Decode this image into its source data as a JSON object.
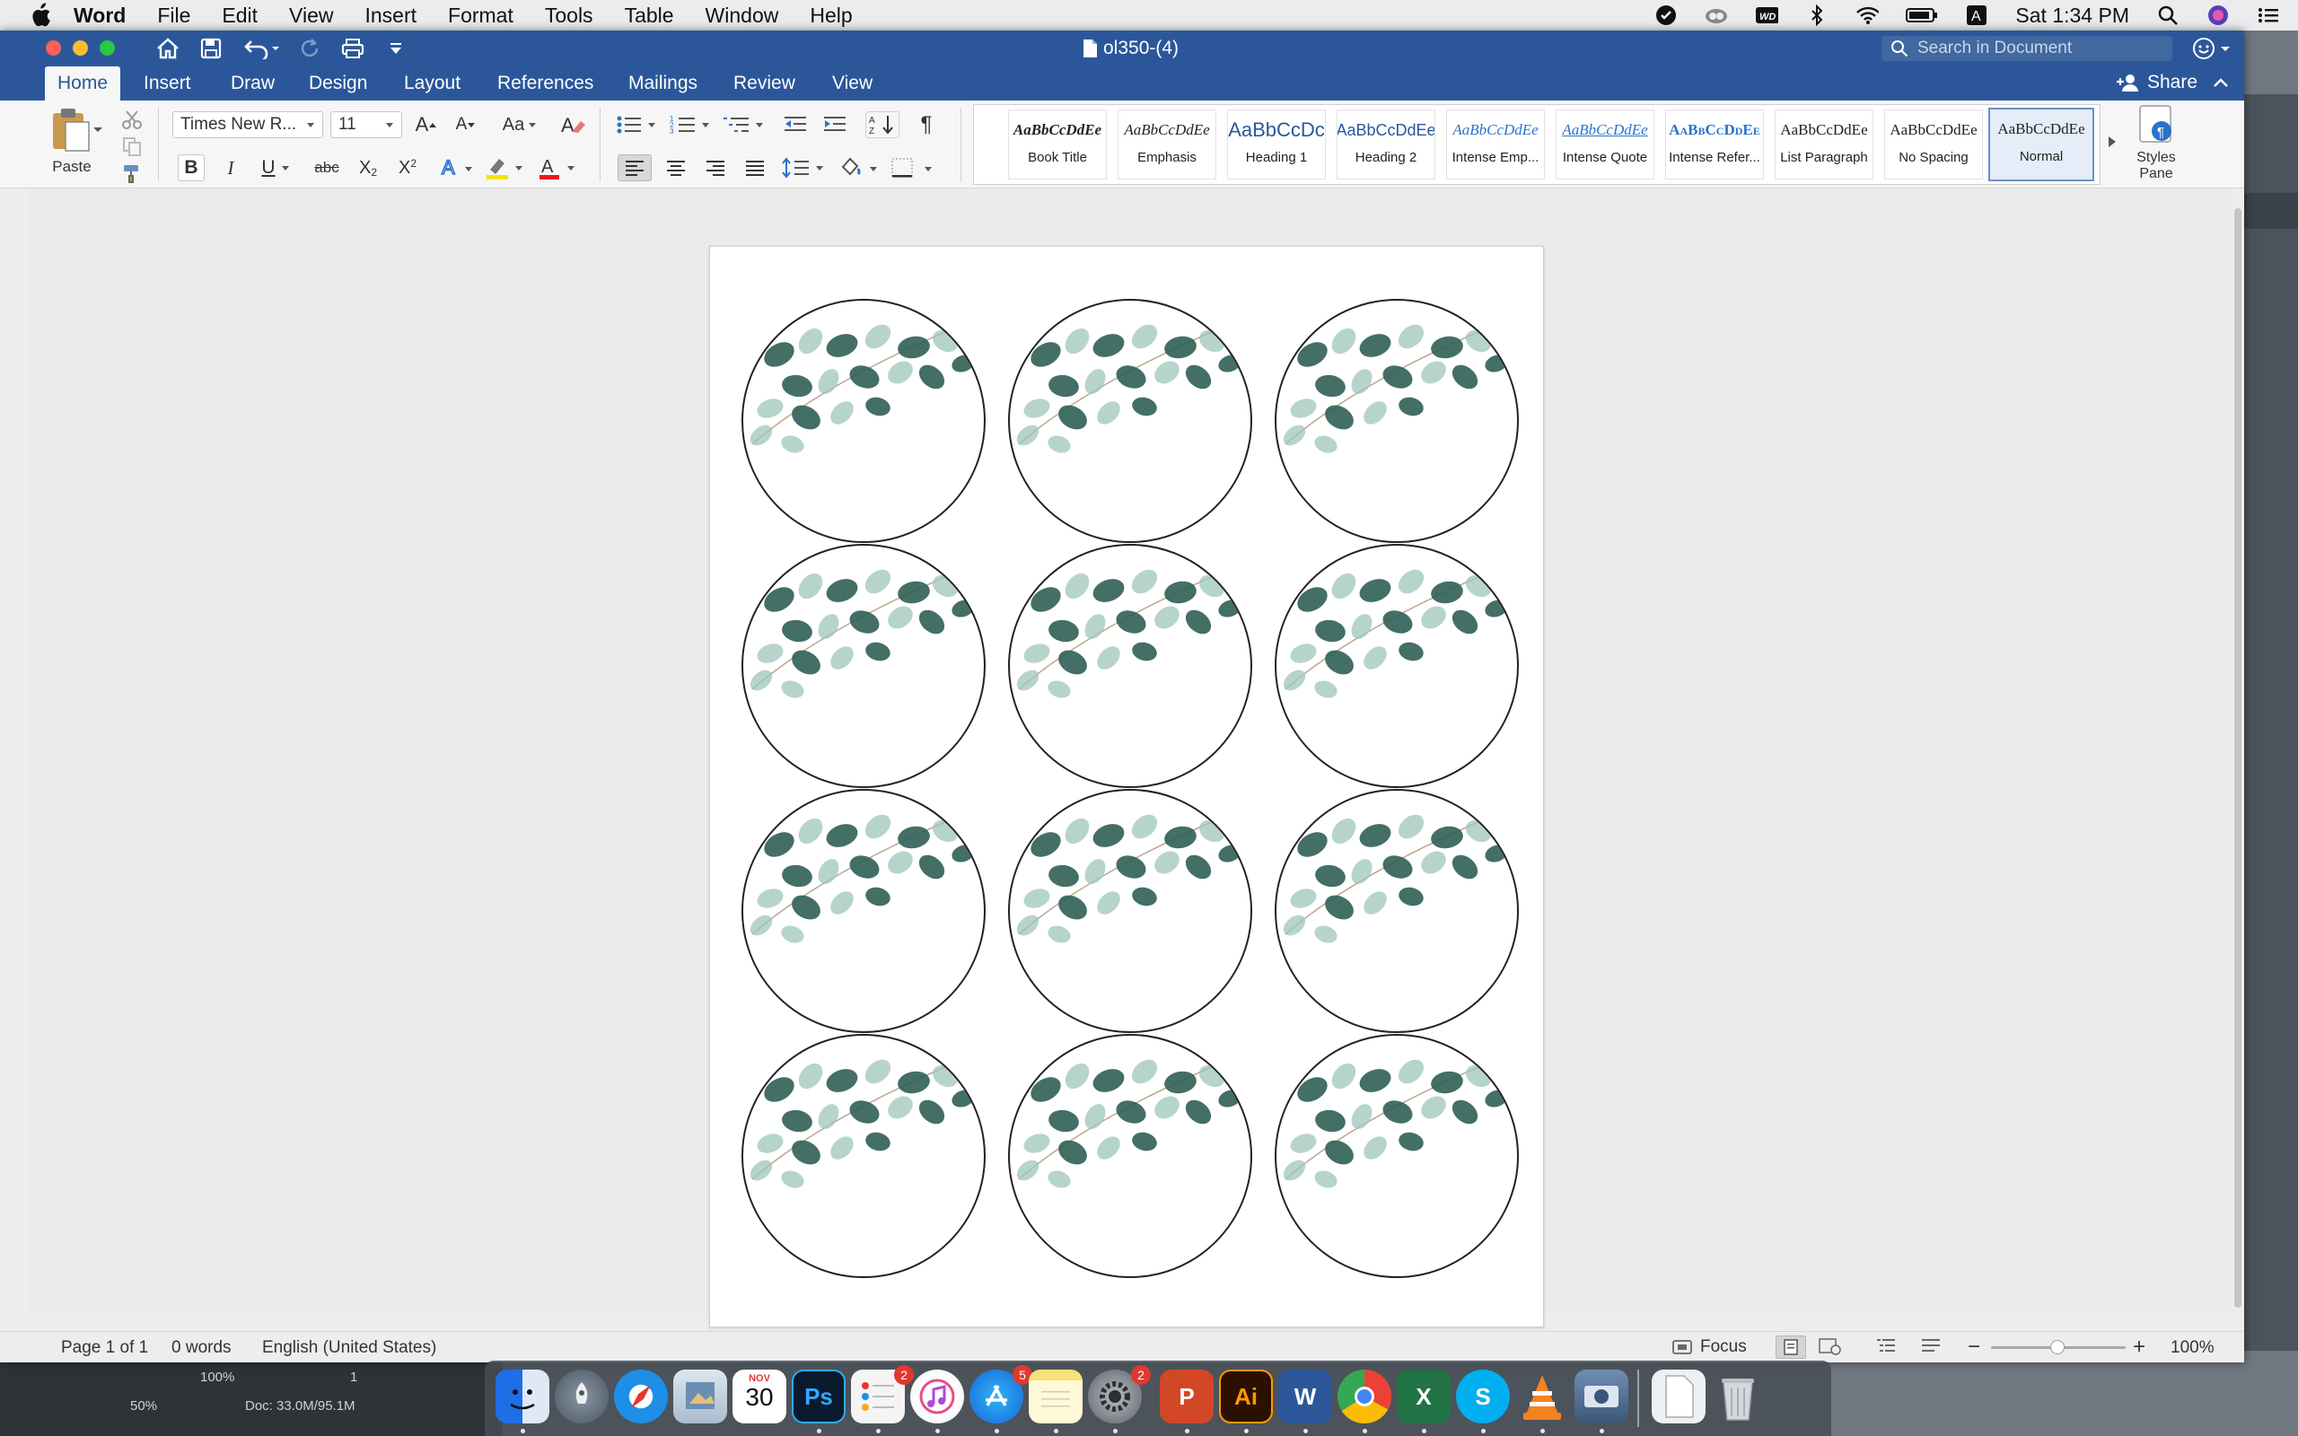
{
  "menubar": {
    "app_name": "Word",
    "items": [
      "File",
      "Edit",
      "View",
      "Insert",
      "Format",
      "Tools",
      "Table",
      "Window",
      "Help"
    ],
    "clock": "Sat 1:34 PM"
  },
  "window": {
    "document_title": "ol350-(4)",
    "search_placeholder": "Search in Document",
    "share_label": "Share"
  },
  "ribbon_tabs": [
    "Home",
    "Insert",
    "Draw",
    "Design",
    "Layout",
    "References",
    "Mailings",
    "Review",
    "View"
  ],
  "ribbon": {
    "paste_label": "Paste",
    "font_name": "Times New R...",
    "font_size": "11",
    "styles_pane_label_1": "Styles",
    "styles_pane_label_2": "Pane"
  },
  "styles": [
    {
      "sample": "AaBbCcDdEe",
      "name": "Book Title"
    },
    {
      "sample": "AaBbCcDdEe",
      "name": "Emphasis"
    },
    {
      "sample": "AaBbCcDc",
      "name": "Heading 1"
    },
    {
      "sample": "AaBbCcDdEe",
      "name": "Heading 2"
    },
    {
      "sample": "AaBbCcDdEe",
      "name": "Intense Emp..."
    },
    {
      "sample": "AaBbCcDdEe",
      "name": "Intense Quote"
    },
    {
      "sample": "AaBbCcDdEe",
      "name": "Intense Refer..."
    },
    {
      "sample": "AaBbCcDdEe",
      "name": "List Paragraph"
    },
    {
      "sample": "AaBbCcDdEe",
      "name": "No Spacing"
    },
    {
      "sample": "AaBbCcDdEe",
      "name": "Normal"
    }
  ],
  "selected_style": "Normal",
  "document": {
    "label_rows": 4,
    "label_cols": 3
  },
  "statusbar": {
    "page": "Page 1 of 1",
    "words": "0 words",
    "language": "English (United States)",
    "focus": "Focus",
    "zoom": "100%"
  },
  "background_app": {
    "zoom_left": "50%",
    "zoom": "100%",
    "page_field": "1",
    "doc_size": "Doc: 33.0M/95.1M"
  },
  "dock": {
    "calendar_month": "NOV",
    "calendar_day": "30",
    "badges": {
      "reminders": "2",
      "app_store": "5",
      "system_prefs": "2"
    }
  },
  "colors": {
    "word_blue": "#2b579a",
    "leaf_dark": "#2f5f55",
    "leaf_light": "#9fc5bb"
  }
}
